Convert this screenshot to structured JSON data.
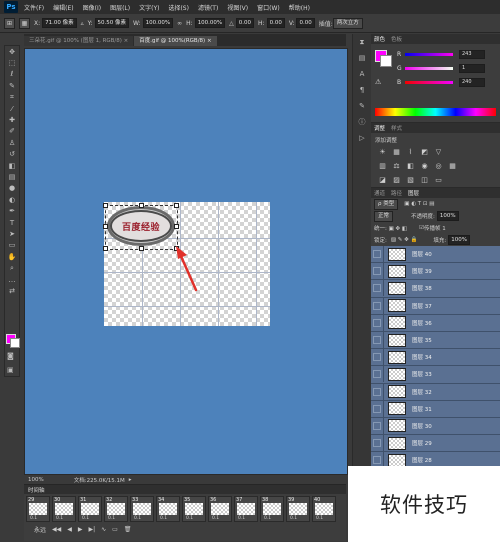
{
  "app": {
    "logo": "Ps"
  },
  "menu": [
    "文件(F)",
    "编辑(E)",
    "图像(I)",
    "图层(L)",
    "文字(Y)",
    "选择(S)",
    "滤镜(T)",
    "视图(V)",
    "窗口(W)",
    "帮助(H)"
  ],
  "options": {
    "x_value": "71.00 像素",
    "y_label": "Y:",
    "y_value": "50.50 像素",
    "w_label": "W:",
    "w_value": "100.00%",
    "h_label": "H:",
    "h_value": "100.00%",
    "angle_value": "0.00",
    "hskew_label": "H:",
    "hskew_value": "0.00",
    "vskew_label": "V:",
    "vskew_value": "0.00",
    "interp_label": "插值:",
    "interp_value": "两次立方"
  },
  "doc_tabs": [
    {
      "label": "三朵花.gif @ 100% (图层 1, RGB/8) ×",
      "active": false
    },
    {
      "label": "百度.gif @ 100%(RGB/8) ×",
      "active": true
    }
  ],
  "canvas": {
    "stamp_text": "百度经验"
  },
  "status": {
    "zoom": "100%",
    "doc_info": "文档:225.0K/15.1M"
  },
  "timeline": {
    "title": "时间轴",
    "frames": [
      {
        "num": "29",
        "time": "0.1"
      },
      {
        "num": "30",
        "time": "0.1"
      },
      {
        "num": "31",
        "time": "0.1"
      },
      {
        "num": "32",
        "time": "0.1"
      },
      {
        "num": "33",
        "time": "0.1"
      },
      {
        "num": "34",
        "time": "0.1"
      },
      {
        "num": "35",
        "time": "0.1"
      },
      {
        "num": "36",
        "time": "0.1"
      },
      {
        "num": "37",
        "time": "0.1"
      },
      {
        "num": "38",
        "time": "0.1"
      },
      {
        "num": "39",
        "time": "0.1"
      },
      {
        "num": "40",
        "time": "0.1"
      }
    ],
    "loop": "永远"
  },
  "panels": {
    "color_tabs": [
      "颜色",
      "色板"
    ],
    "color": {
      "r": "243",
      "g": "1",
      "b": "240",
      "fg_color": "#ff00ff"
    },
    "adjust_tabs": [
      "调整",
      "样式"
    ],
    "adjust_title": "添加调整",
    "layers_tabs": [
      "通道",
      "路径",
      "图层"
    ],
    "layers_kind": "ρ 类型",
    "blend_mode": "正常",
    "opacity_label": "不透明度:",
    "opacity": "100%",
    "lock_label": "锁定:",
    "fill_label": "填充:",
    "fill": "100%",
    "unify_label": "传播帧 1",
    "layers": [
      "图层 40",
      "图层 39",
      "图层 38",
      "图层 37",
      "图层 36",
      "图层 35",
      "图层 34",
      "图层 33",
      "图层 32",
      "图层 31",
      "图层 30",
      "图层 29",
      "图层 28"
    ]
  },
  "watermark": "软件技巧"
}
